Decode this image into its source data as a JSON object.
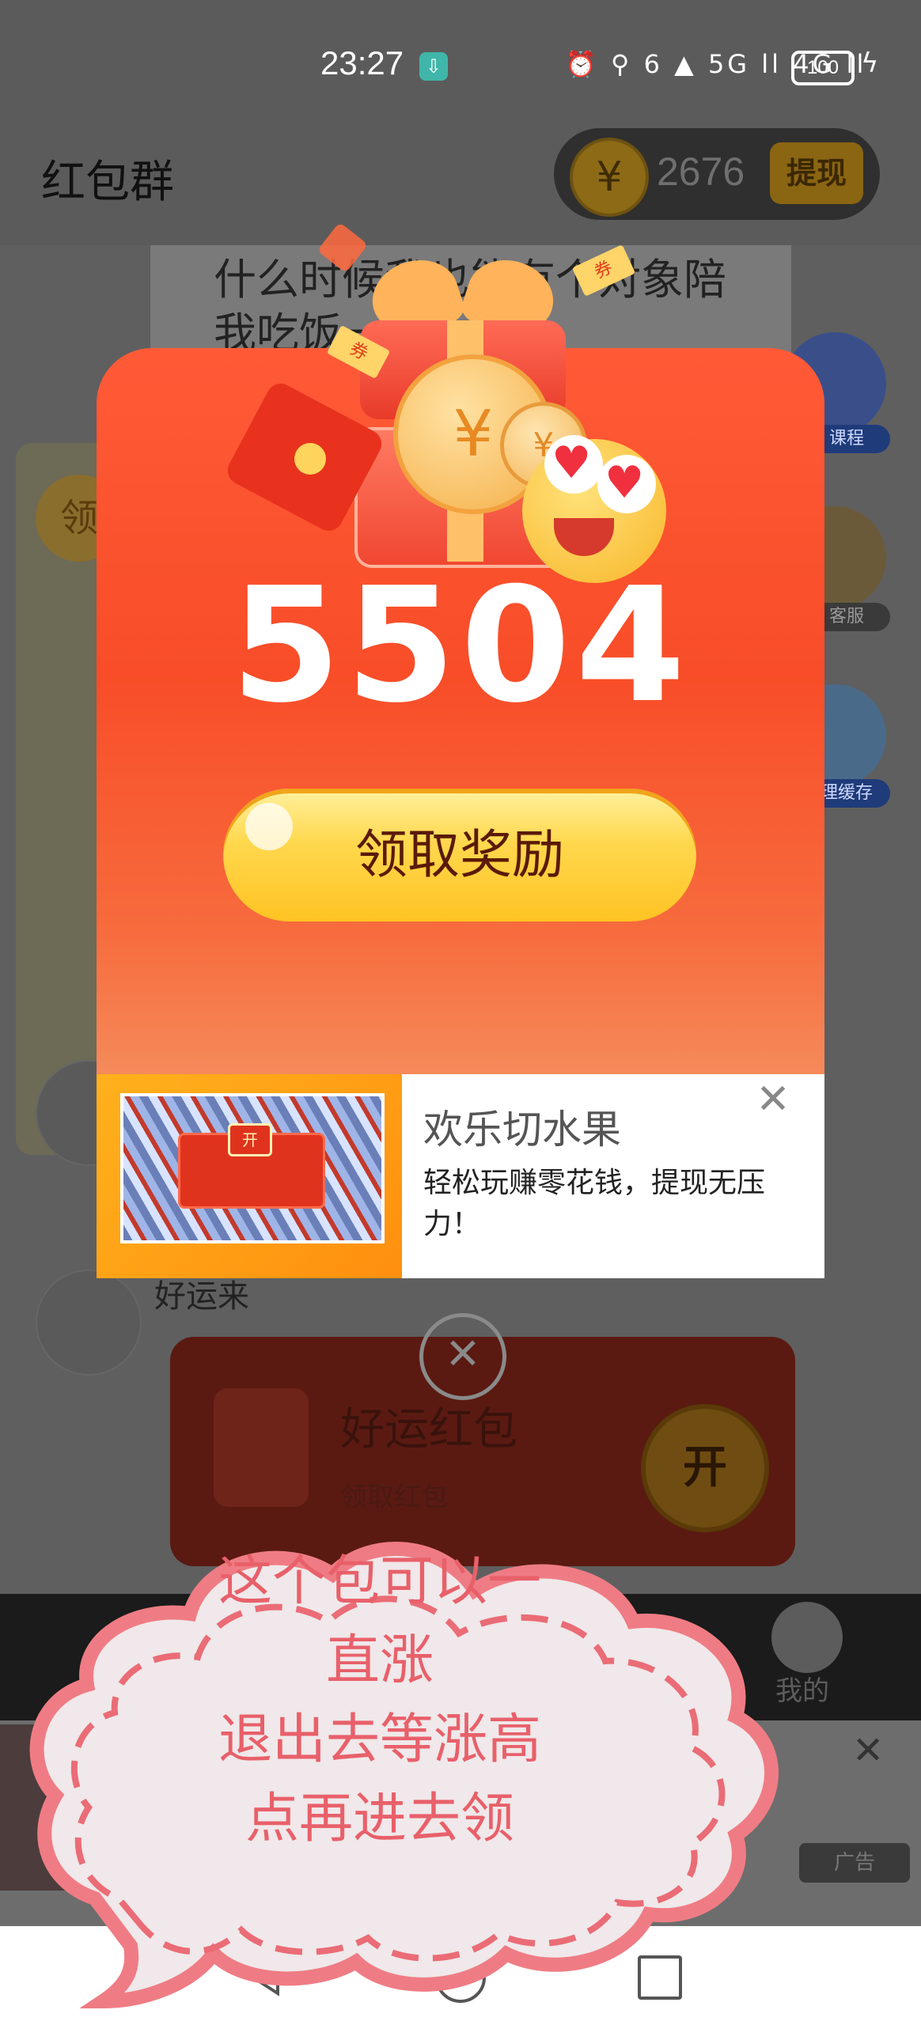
{
  "status_bar": {
    "time": "23:27",
    "download_glyph": "⇩",
    "icons": "⏰ ⚲ 6 ▲ 5G ll 4G ll",
    "battery": "100",
    "charging_glyph": "ϟ"
  },
  "header": {
    "title": "红包群",
    "coin_symbol": "¥",
    "coin_count": "2676",
    "withdraw_label": "提现"
  },
  "chat": {
    "top_message": "什么时候我也能有个对象陪我吃饭一起",
    "left_badge": "领",
    "good_luck": "好运来",
    "redpack_title": "好运红包",
    "redpack_sub": "领取红包",
    "open_label": "开"
  },
  "side_icons": {
    "course_label": "课程",
    "service_label": "客服",
    "cache_label": "理缓存"
  },
  "reward_modal": {
    "amount": "5504",
    "claim_label": "领取奖励",
    "coin_glyph": "¥",
    "ticket_a": "券",
    "ticket_b": "券",
    "heart_glyph": "♥"
  },
  "ad_card": {
    "title": "欢乐切水果",
    "description": "轻松玩赚零花钱，提现无压力！",
    "close_glyph": "✕",
    "thumb_badge": "开"
  },
  "modal_close_glyph": "✕",
  "tab_bar": {
    "me_label": "我的"
  },
  "bottom_ad": {
    "close_glyph": "✕",
    "tag": "广告"
  },
  "sticker": {
    "lines": [
      "这个包可以一",
      "直涨",
      "退出去等涨高",
      "点再进去领"
    ]
  },
  "colors": {
    "modal_top": "#ff5a37",
    "claim_button": "#ffd84e",
    "sticker_text": "#e8606a"
  }
}
